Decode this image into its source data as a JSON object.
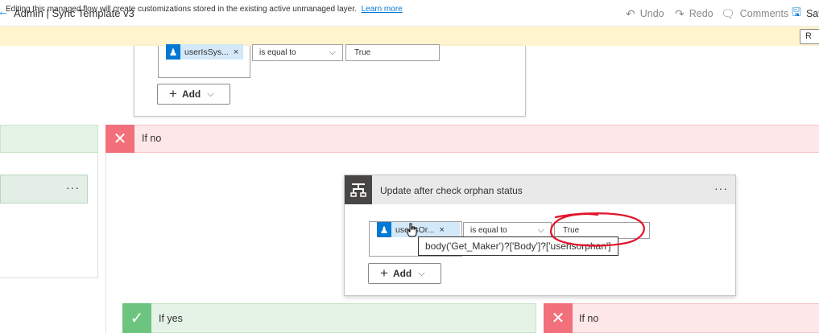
{
  "titlebar": {
    "title": "Admin | Sync Template v3",
    "undo": "Undo",
    "redo": "Redo",
    "comments": "Comments",
    "save": "Sav"
  },
  "warning": {
    "text": "Editing this managed flow will create customizations stored in the existing active unmanaged layer.",
    "link": "Learn more",
    "button": "R"
  },
  "top_condition": {
    "token": "userIsSys...",
    "operator": "is equal to",
    "value": "True",
    "add_label": "Add"
  },
  "branches": {
    "if_no_label": "If no"
  },
  "update_card": {
    "title": "Update after check orphan status",
    "token": "userIsOr...",
    "operator": "is equal to",
    "value": "True",
    "add_label": "Add",
    "tooltip": "body('Get_Maker')?['Body']?['userisorphan']"
  },
  "bottom_branches": {
    "yes_label": "If yes",
    "no_label": "If no"
  },
  "colors": {
    "accent": "#0078d4",
    "warning_bg": "#fff4ce",
    "no_bg": "#fde7e9",
    "no_icon": "#f1707b",
    "yes_bg": "#e5f3e7",
    "yes_icon": "#6cc47f",
    "annotation": "#e3132b"
  }
}
